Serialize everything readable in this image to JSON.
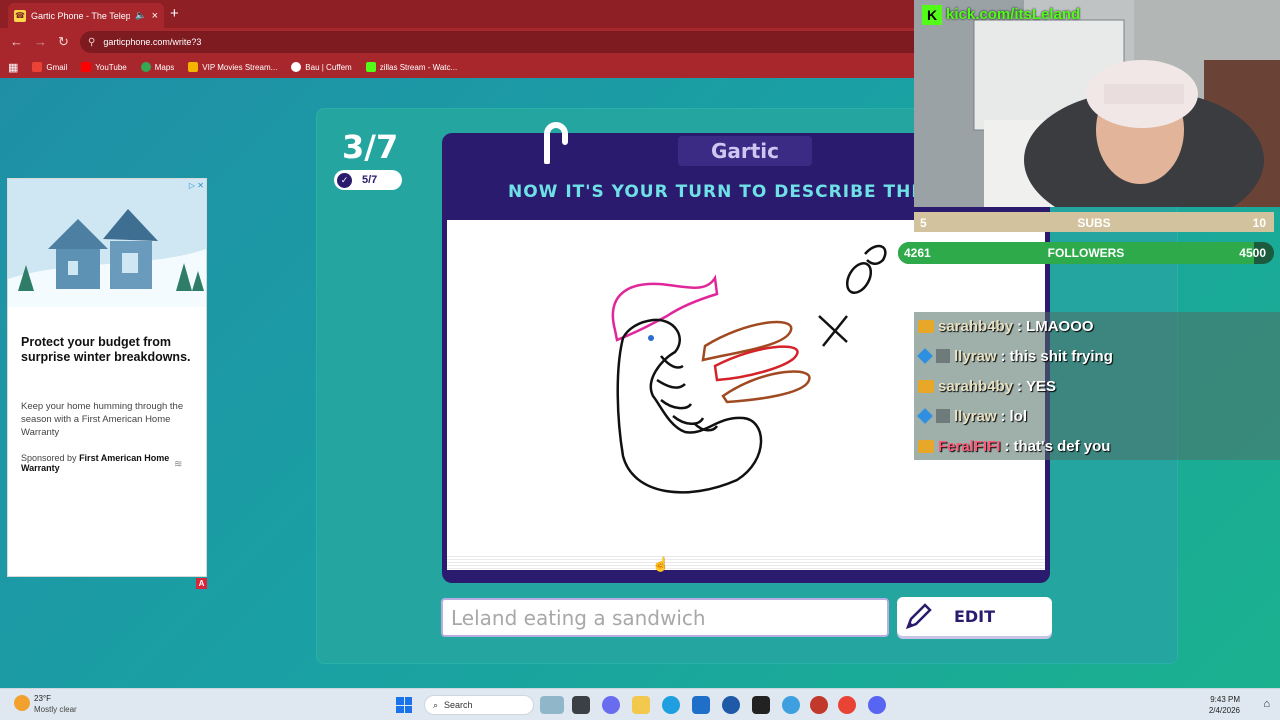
{
  "browser": {
    "tab_title": "Gartic Phone - The Telephone",
    "url": "garticphone.com/write?3",
    "bookmarks": [
      {
        "label": "Gmail",
        "color": "#ea4335"
      },
      {
        "label": "YouTube",
        "color": "#ff0000"
      },
      {
        "label": "Maps",
        "color": "#34a853"
      },
      {
        "label": "VIP Movies Stream...",
        "color": "#f4b400"
      },
      {
        "label": "Bau | Cuffem",
        "color": "#ffffff"
      },
      {
        "label": "zillas Stream - Watc...",
        "color": "#53fc18"
      }
    ]
  },
  "game": {
    "round": "3/7",
    "done_count": "5/7",
    "logo": "Gartic",
    "prompt": "NOW IT'S YOUR TURN TO DESCRIBE THIS",
    "description_value": "Leland eating a sandwich",
    "edit_label": "EDIT"
  },
  "ad": {
    "choices_icon": "ad-choices-icon",
    "headline": "Protect your budget from surprise winter breakdowns.",
    "body": "Keep your home humming through the season with a First American Home Warranty",
    "sponsor_prefix": "Sponsored by",
    "sponsor_name": "First American Home Warranty",
    "badge": "A"
  },
  "stream": {
    "kick_logo": "K",
    "kick_url": "kick.com/itsLeland",
    "subs_goal": {
      "current": "5",
      "label": "SUBS",
      "target": "10",
      "progress": 0.5
    },
    "follower_goal": {
      "current": "4261",
      "label": "FOLLOWERS",
      "target": "4500",
      "progress": 0.947
    },
    "chat": [
      {
        "user": "sarahb4by",
        "badges": [
          "crown"
        ],
        "message": "LMAOOO"
      },
      {
        "user": "llyraw",
        "badges": [
          "gem",
          "avatar"
        ],
        "message": "this shit frying"
      },
      {
        "user": "sarahb4by",
        "badges": [
          "crown"
        ],
        "message": "YES"
      },
      {
        "user": "llyraw",
        "badges": [
          "gem",
          "avatar"
        ],
        "message": "lol"
      },
      {
        "user": "FeralFIFI",
        "badges": [
          "crown"
        ],
        "message": "that's def you"
      }
    ]
  },
  "taskbar": {
    "temperature": "23°F",
    "weather": "Mostly clear",
    "search_placeholder": "Search",
    "time": "9:43 PM",
    "date": "2/4/2026"
  }
}
